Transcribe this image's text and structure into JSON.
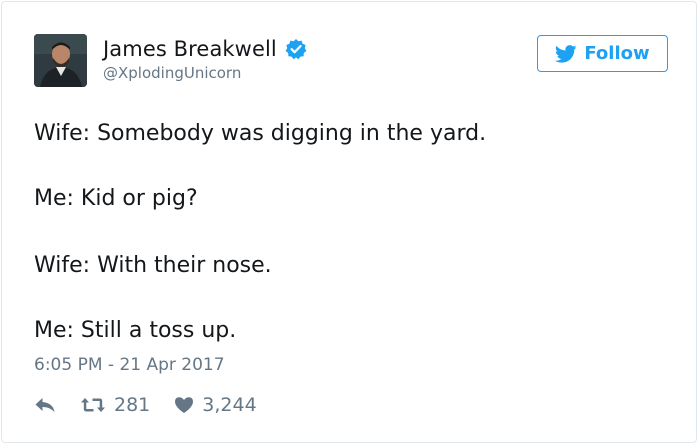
{
  "author": {
    "display_name": "James Breakwell",
    "handle": "@XplodingUnicorn",
    "verified": true
  },
  "follow_button": {
    "label": "Follow"
  },
  "tweet": {
    "lines": [
      "Wife: Somebody was digging in the yard.",
      "Me: Kid or pig?",
      "Wife: With their nose.",
      "Me: Still a toss up."
    ],
    "timestamp": "6:05 PM - 21 Apr 2017"
  },
  "actions": {
    "retweet_count": "281",
    "like_count": "3,244"
  },
  "icons": {
    "avatar": "avatar-photo",
    "verified": "verified-badge-icon",
    "follow": "twitter-bird-icon",
    "reply": "reply-arrow-icon",
    "retweet": "retweet-icon",
    "like": "heart-icon"
  },
  "colors": {
    "accent": "#1da1f2",
    "text": "#14171a",
    "muted": "#657786",
    "border": "#e1e8ed"
  }
}
